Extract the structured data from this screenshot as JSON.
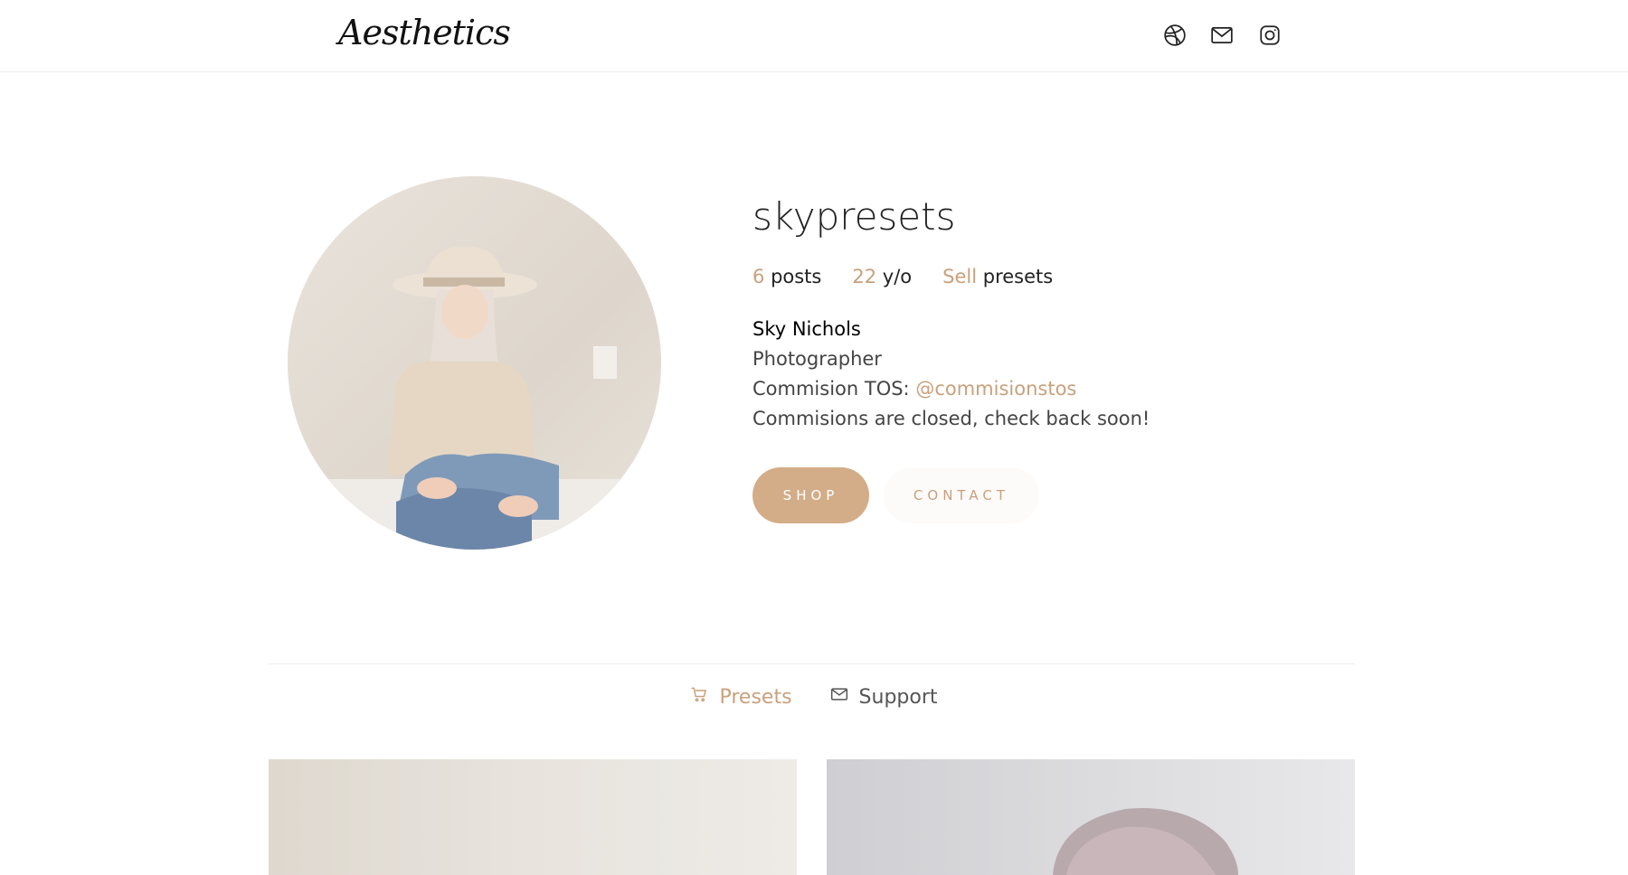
{
  "header": {
    "logo_text": "Aesthetics",
    "icons": [
      "dribbble-icon",
      "mail-icon",
      "instagram-icon"
    ]
  },
  "profile": {
    "username": "skypresets",
    "stats": [
      {
        "value": "6",
        "label": "posts"
      },
      {
        "value": "22",
        "label": "y/o"
      },
      {
        "value": "Sell",
        "label": "presets"
      }
    ],
    "bio": {
      "name": "Sky Nichols",
      "occupation": "Photographer",
      "tos_prefix": "Commision TOS:",
      "tos_handle": "@commisionstos",
      "status": "Commisions are closed, check back soon!"
    },
    "buttons": {
      "shop": "SHOP",
      "contact": "CONTACT"
    }
  },
  "tabs": [
    {
      "label": "Presets",
      "icon": "cart-icon",
      "active": true
    },
    {
      "label": "Support",
      "icon": "mail-icon",
      "active": false
    }
  ],
  "colors": {
    "accent": "#c9a07c",
    "button_fill": "#d3ad88",
    "divider": "#ececec"
  }
}
